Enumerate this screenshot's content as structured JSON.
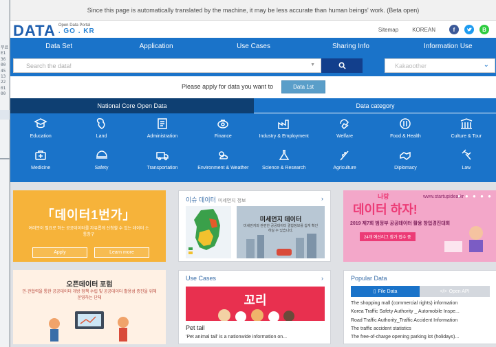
{
  "background_window": {
    "lines": [
      "무료",
      "E1",
      "36",
      "00",
      "45",
      "13",
      "22",
      "01",
      "00"
    ]
  },
  "notice": "Since this page is automatically translated by the machine, it may be less accurate than human beings' work. (Beta open)",
  "header": {
    "logo_main": "DATA",
    "logo_sub": "Open Data Portal",
    "logo_gokr": ". GO . KR",
    "sitemap": "Sitemap",
    "language": "KOREAN",
    "social": {
      "facebook": "f",
      "blog": "B"
    }
  },
  "nav": [
    "Data Set",
    "Application",
    "Use Cases",
    "Sharing Info",
    "Information Use"
  ],
  "search": {
    "placeholder": "Search the data!",
    "select_value": "Kakaoother"
  },
  "apply": {
    "text": "Please apply for data you want to",
    "button": "Data 1st"
  },
  "tabs": {
    "national": "National Core Open Data",
    "category": "Data category"
  },
  "categories": [
    {
      "label": "Education",
      "icon": "education-icon"
    },
    {
      "label": "Land",
      "icon": "land-icon"
    },
    {
      "label": "Administration",
      "icon": "administration-icon"
    },
    {
      "label": "Finance",
      "icon": "finance-icon"
    },
    {
      "label": "Industry & Employment",
      "icon": "industry-icon"
    },
    {
      "label": "Welfare",
      "icon": "welfare-icon"
    },
    {
      "label": "Food & Health",
      "icon": "food-icon"
    },
    {
      "label": "Culture & Tour",
      "icon": "culture-icon"
    },
    {
      "label": "Medicine",
      "icon": "medicine-icon"
    },
    {
      "label": "Safety",
      "icon": "safety-icon"
    },
    {
      "label": "Transportation",
      "icon": "transportation-icon"
    },
    {
      "label": "Environment & Weather",
      "icon": "environment-icon"
    },
    {
      "label": "Science & Research",
      "icon": "science-icon"
    },
    {
      "label": "Agriculture",
      "icon": "agriculture-icon"
    },
    {
      "label": "Diplomacy",
      "icon": "diplomacy-icon"
    },
    {
      "label": "Law",
      "icon": "law-icon"
    }
  ],
  "promo": {
    "big": "「데이터1번가」",
    "small": "여러분이 필요로 하는 공공데이터를 자유롭게 신청할 수 있는 데이터 소통창구",
    "apply_button": "Apply",
    "learn_button": "Learn more"
  },
  "issue": {
    "title": "이슈 데이터",
    "subtitle": "미세먼지 정보",
    "arrow": "›",
    "image_title": "미세먼지 데이터",
    "image_desc": "미세먼지와 관련한 공공데이터 결합정보를 쉽게 확인하실 수 있습니다."
  },
  "event": {
    "headline": "데이터 하자!",
    "tagline": "나랑",
    "mid": "2019 제7회 범정부 공공데이터 활용 창업경진대회",
    "date": "24개 예선리그 참가 접수 중",
    "url": "www.startupidea.kr",
    "dots": "● ● ● ● ●"
  },
  "forum": {
    "title": "오픈데이터 포럼",
    "subtitle": "민·관협력을 통한 공공데이터 개방 정책 수립 및 공공데이터 활용성 증진을 위해 운영하는 단체"
  },
  "usecase": {
    "header": "Use Cases",
    "arrow": "›",
    "image_logo": "꼬리",
    "name": "Pet tail",
    "desc": "'Pet animal tail' is a nationwide information on..."
  },
  "popular": {
    "header": "Popular Data",
    "tab_file": "File Data",
    "tab_api": "Open API",
    "items": [
      "The shopping mall (commercial rights) information",
      "Korea Traffic Safety Authority _ Automobile Inspe...",
      "Road Traffic Authority_Traffic Accident Information",
      "The traffic accident statistics",
      "The free-of-charge opening parking lot (holidays)..."
    ]
  },
  "colors": {
    "brand_blue": "#1a73c9",
    "dark_navy": "#0e3f72",
    "promo_orange": "#f6b33a",
    "event_pink": "#f3a7c9",
    "usecase_red": "#e8304f"
  }
}
